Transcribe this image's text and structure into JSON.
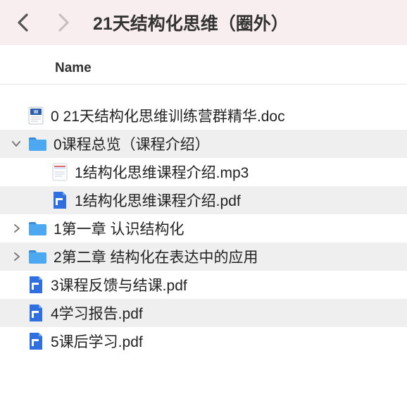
{
  "titlebar": {
    "title": "21天结构化思维（圈外）"
  },
  "columns": {
    "name": "Name"
  },
  "items": [
    {
      "expander": "none",
      "icon": "doc",
      "indent": 0,
      "alt": false,
      "name": "0 21天结构化思维训练营群精华.doc"
    },
    {
      "expander": "open",
      "icon": "folder",
      "indent": 0,
      "alt": true,
      "name": "0课程总览（课程介绍）"
    },
    {
      "expander": "none",
      "icon": "mp3",
      "indent": 1,
      "alt": false,
      "name": "1结构化思维课程介绍.mp3"
    },
    {
      "expander": "none",
      "icon": "pdf",
      "indent": 1,
      "alt": true,
      "name": "1结构化思维课程介绍.pdf"
    },
    {
      "expander": "closed",
      "icon": "folder",
      "indent": 0,
      "alt": false,
      "name": "1第一章 认识结构化"
    },
    {
      "expander": "closed",
      "icon": "folder",
      "indent": 0,
      "alt": true,
      "name": "2第二章 结构化在表达中的应用"
    },
    {
      "expander": "none",
      "icon": "pdf",
      "indent": 0,
      "alt": false,
      "name": "3课程反馈与结课.pdf"
    },
    {
      "expander": "none",
      "icon": "pdf",
      "indent": 0,
      "alt": true,
      "name": "4学习报告.pdf"
    },
    {
      "expander": "none",
      "icon": "pdf",
      "indent": 0,
      "alt": false,
      "name": "5课后学习.pdf"
    }
  ]
}
